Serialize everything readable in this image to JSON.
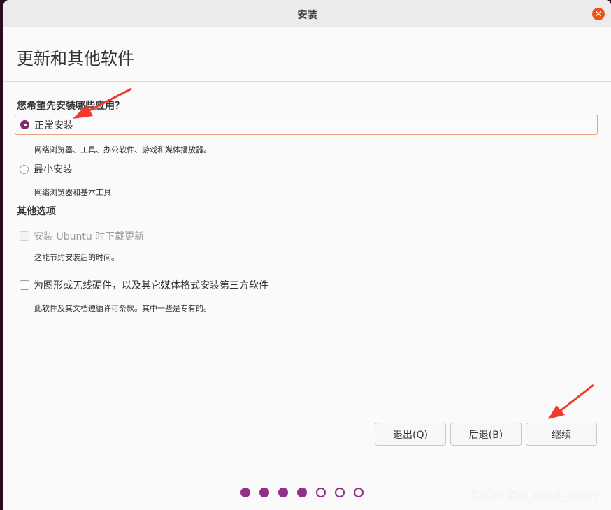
{
  "window": {
    "title": "安装",
    "close_glyph": "✕"
  },
  "page": {
    "title": "更新和其他软件"
  },
  "install_type": {
    "question": "您希望先安装哪些应用？",
    "options": [
      {
        "label": "正常安装",
        "description": "网络浏览器、工具、办公软件、游戏和媒体播放器。",
        "selected": true
      },
      {
        "label": "最小安装",
        "description": "网络浏览器和基本工具",
        "selected": false
      }
    ]
  },
  "other_options": {
    "heading": "其他选项",
    "items": [
      {
        "label": "安装 Ubuntu 时下载更新",
        "description": "这能节约安装后的时间。",
        "checked": false,
        "disabled": true
      },
      {
        "label": "为图形或无线硬件，以及其它媒体格式安装第三方软件",
        "description": "此软件及其文档遵循许可条款。其中一些是专有的。",
        "checked": false,
        "disabled": false
      }
    ]
  },
  "buttons": {
    "quit": "退出(Q)",
    "back": "后退(B)",
    "continue": "继续"
  },
  "progress": {
    "total_steps": 7,
    "completed_steps": 4
  },
  "watermark": "CSDN @a_small_cherry",
  "colors": {
    "accent": "#923089",
    "radio_selected": "#7e2d68",
    "close_button": "#e95420",
    "annotation_arrow": "#f03a2e"
  }
}
